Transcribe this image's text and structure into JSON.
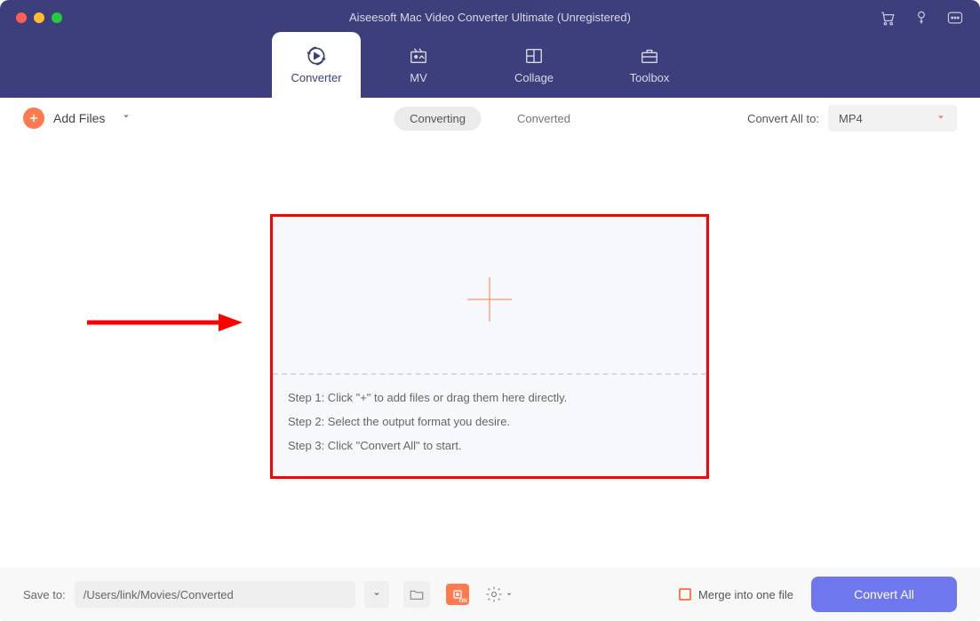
{
  "title": "Aiseesoft Mac Video Converter Ultimate (Unregistered)",
  "tabs": {
    "converter": "Converter",
    "mv": "MV",
    "collage": "Collage",
    "toolbox": "Toolbox"
  },
  "toolbar": {
    "add_files": "Add Files",
    "converting": "Converting",
    "converted": "Converted",
    "convert_all_to": "Convert All to:",
    "format": "MP4"
  },
  "dropzone": {
    "step1": "Step 1: Click \"+\" to add files or drag them here directly.",
    "step2": "Step 2: Select the output format you desire.",
    "step3": "Step 3: Click \"Convert All\" to start."
  },
  "footer": {
    "save_to_label": "Save to:",
    "path": "/Users/link/Movies/Converted",
    "merge_label": "Merge into one file",
    "convert_all": "Convert All"
  },
  "colors": {
    "header_bg": "#3c3f7b",
    "accent_orange": "#ff7a4f",
    "primary_button": "#6f77ee",
    "annotation_red": "#ff0000"
  }
}
